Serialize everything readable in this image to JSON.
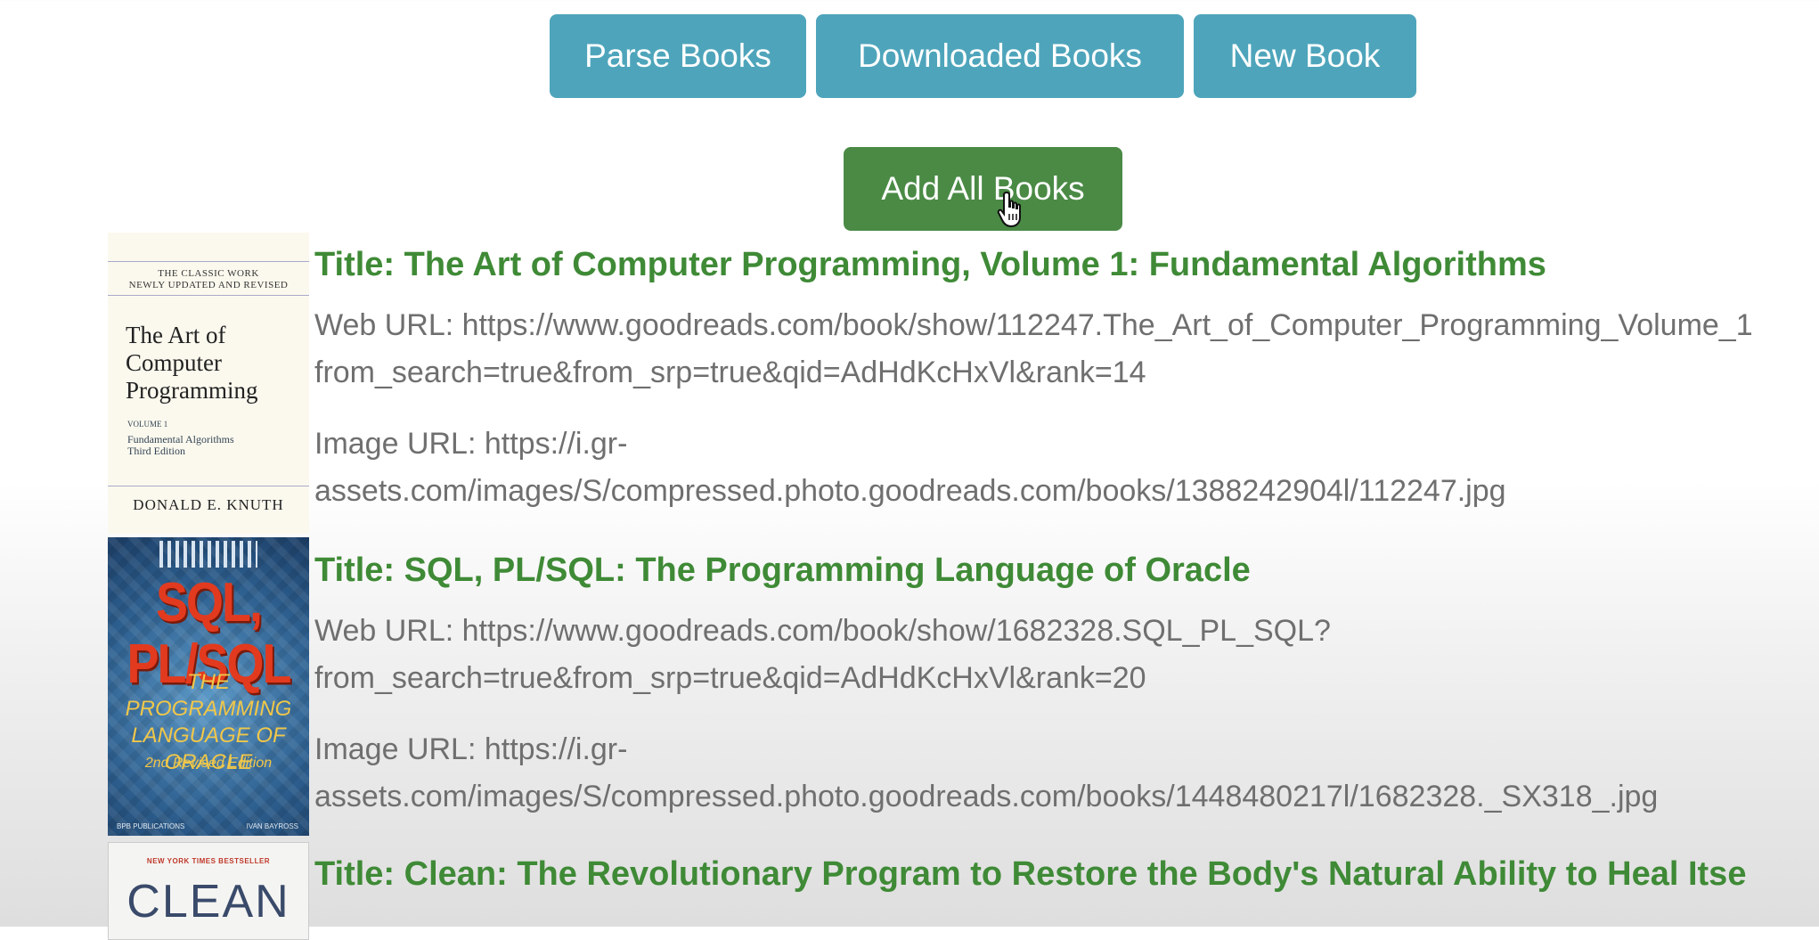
{
  "toolbar": {
    "parse_label": "Parse Books",
    "downloaded_label": "Downloaded Books",
    "new_label": "New Book",
    "add_all_label": "Add All Books"
  },
  "colors": {
    "info_button": "#4ea5bb",
    "success_button": "#4a8a45",
    "title_green": "#3f8a36",
    "text_gray": "#6f6f6f"
  },
  "books": [
    {
      "title": "Title: The Art of Computer Programming, Volume 1: Fundamental Algorithms",
      "web_url_line1": "Web URL: https://www.goodreads.com/book/show/112247.The_Art_of_Computer_Programming_Volume_1",
      "web_url_line2": "from_search=true&from_srp=true&qid=AdHdKcHxVl&rank=14",
      "image_url_line1": "Image URL: https://i.gr-",
      "image_url_line2": "assets.com/images/S/compressed.photo.goodreads.com/books/1388242904l/112247.jpg",
      "cover": {
        "top_text": "The Classic Work\nNewly Updated and Revised",
        "title": "The Art of\nComputer\nProgramming",
        "volume": "VOLUME 1",
        "subtitle": "Fundamental Algorithms\nThird Edition",
        "author": "DONALD E. KNUTH"
      }
    },
    {
      "title": "Title: SQL, PL/SQL: The Programming Language of Oracle",
      "web_url_line1": "Web URL: https://www.goodreads.com/book/show/1682328.SQL_PL_SQL?",
      "web_url_line2": "from_search=true&from_srp=true&qid=AdHdKcHxVl&rank=20",
      "image_url_line1": "Image URL: https://i.gr-",
      "image_url_line2": "assets.com/images/S/compressed.photo.goodreads.com/books/1448480217l/1682328._SX318_.jpg",
      "cover": {
        "title": "SQL, PL/SQL",
        "subtitle": "THE PROGRAMMING LANGUAGE OF ORACLE",
        "edition": "2nd Revised Edition",
        "publisher": "BPB PUBLICATIONS",
        "author": "IVAN BAYROSS"
      }
    },
    {
      "title": "Title: Clean: The Revolutionary Program to Restore the Body's Natural Ability to Heal Itse",
      "cover": {
        "badge": "NEW YORK TIMES BESTSELLER",
        "title": "CLEAN"
      }
    }
  ]
}
